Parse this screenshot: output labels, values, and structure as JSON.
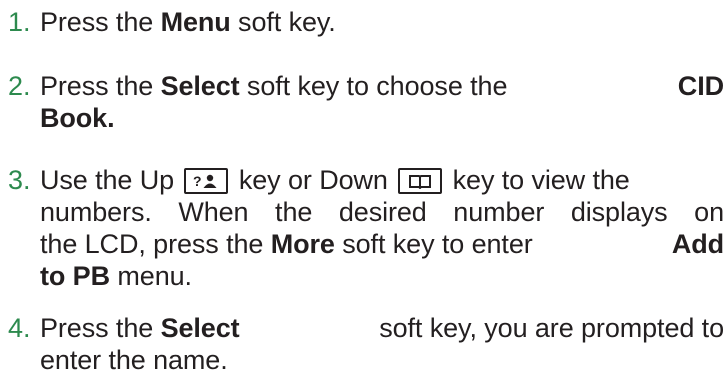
{
  "steps": [
    {
      "number": "1.",
      "parts": [
        "Press the ",
        "Menu",
        " soft key."
      ]
    },
    {
      "number": "2.",
      "parts": [
        "Press the ",
        "Select",
        " soft key to choose the ",
        "CID",
        "Book."
      ]
    },
    {
      "number": "3.",
      "parts": [
        "Use the Up ",
        " key or Down ",
        " key to view the",
        "numbers. When the desired number displays on",
        "the LCD, press the ",
        "More",
        " soft key to enter ",
        "Add",
        "to PB",
        " menu."
      ]
    },
    {
      "number": "4.",
      "parts": [
        "Press the ",
        "Select",
        " soft key, you are prompted to",
        "enter the name."
      ]
    }
  ],
  "icons": {
    "up_key": "phonebook-up-icon",
    "down_key": "book-down-icon"
  },
  "colors": {
    "step_number": "#2d8a4e",
    "text": "#231f20"
  }
}
